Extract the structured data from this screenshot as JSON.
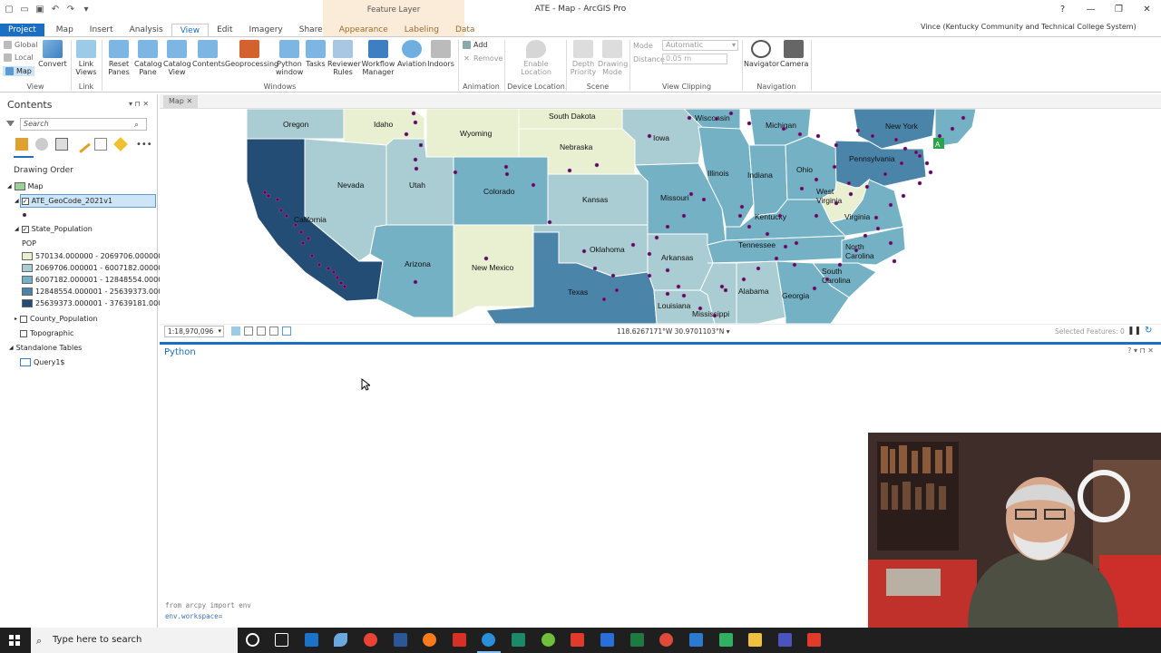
{
  "window": {
    "title": "ATE - Map - ArcGIS Pro",
    "context_group": "Feature Layer",
    "user": "Vince (Kentucky Community and Technical College System)",
    "help": "?"
  },
  "tabs": [
    {
      "label": "Project"
    },
    {
      "label": "Map"
    },
    {
      "label": "Insert"
    },
    {
      "label": "Analysis"
    },
    {
      "label": "View"
    },
    {
      "label": "Edit"
    },
    {
      "label": "Imagery"
    },
    {
      "label": "Share"
    },
    {
      "label": "Appearance"
    },
    {
      "label": "Labeling"
    },
    {
      "label": "Data"
    }
  ],
  "ribbon": {
    "view_group": {
      "global": "Global",
      "local": "Local",
      "map": "Map",
      "label": "View"
    },
    "convert": "Convert",
    "link": {
      "link_views_1": "Link",
      "link_views_2": "Views",
      "label": "Link"
    },
    "windows": {
      "reset_panes_1": "Reset",
      "reset_panes_2": "Panes",
      "catalog_pane_1": "Catalog",
      "catalog_pane_2": "Pane",
      "catalog_view_1": "Catalog",
      "catalog_view_2": "View",
      "contents": "Contents",
      "geoprocessing": "Geoprocessing",
      "python_1": "Python",
      "python_2": "window",
      "tasks": "Tasks",
      "reviewer_1": "Reviewer",
      "reviewer_2": "Rules",
      "workflow_1": "Workflow",
      "workflow_2": "Manager",
      "aviation": "Aviation",
      "indoors": "Indoors",
      "label": "Windows"
    },
    "animation": {
      "add": "Add",
      "remove": "Remove",
      "label": "Animation"
    },
    "device_location": {
      "enable_1": "Enable",
      "enable_2": "Location",
      "label": "Device Location"
    },
    "scene": {
      "depth_1": "Depth",
      "depth_2": "Priority",
      "drawing_1": "Drawing",
      "drawing_2": "Mode",
      "label": "Scene"
    },
    "clipping": {
      "mode_label": "Mode",
      "mode_value": "Automatic",
      "distance_label": "Distance",
      "distance_value": "0.05 m",
      "label": "View Clipping"
    },
    "navigation": {
      "navigator": "Navigator",
      "camera": "Camera",
      "label": "Navigation"
    }
  },
  "contents": {
    "title": "Contents",
    "search_placeholder": "Search",
    "drawing_order": "Drawing Order",
    "map": "Map",
    "layer_selected": "ATE_GeoCode_2021v1",
    "layer_state": "State_Population",
    "field": "POP",
    "legend": [
      {
        "label": "570134.000000 - 2069706.000000",
        "color": "#e9efd1"
      },
      {
        "label": "2069706.000001 - 6007182.000000",
        "color": "#a9cdd2"
      },
      {
        "label": "6007182.000001 - 12848554.000000",
        "color": "#74b1c4"
      },
      {
        "label": "12848554.000001 - 25639373.000000",
        "color": "#4a84a9"
      },
      {
        "label": "25639373.000001 - 37639181.000000",
        "color": "#234d75"
      }
    ],
    "county": "County_Population",
    "topographic": "Topographic",
    "standalone": "Standalone Tables",
    "query": "Query1$"
  },
  "map": {
    "tab": "Map",
    "scale": "1:18,970,096",
    "coords": "118.6267171°W 30.9701103°N",
    "selected": "Selected Features: 0",
    "states": [
      "Oregon",
      "Idaho",
      "Wyoming",
      "South Dakota",
      "Wisconsin",
      "Michigan",
      "New York",
      "Iowa",
      "Nebraska",
      "Nevada",
      "Utah",
      "Colorado",
      "Illinois",
      "Indiana",
      "Ohio",
      "Pennsylvania",
      "California",
      "Kansas",
      "Missouri",
      "West Virginia",
      "Virginia",
      "Kentucky",
      "Oklahoma",
      "Tennessee",
      "North Carolina",
      "Arizona",
      "New Mexico",
      "Arkansas",
      "South Carolina",
      "Texas",
      "Alabama",
      "Georgia",
      "Louisiana",
      "Mississippi"
    ]
  },
  "python": {
    "title": "Python",
    "line1": "from arcpy import env",
    "line2": "env.workspace="
  },
  "taskbar": {
    "search": "Type here to search"
  }
}
